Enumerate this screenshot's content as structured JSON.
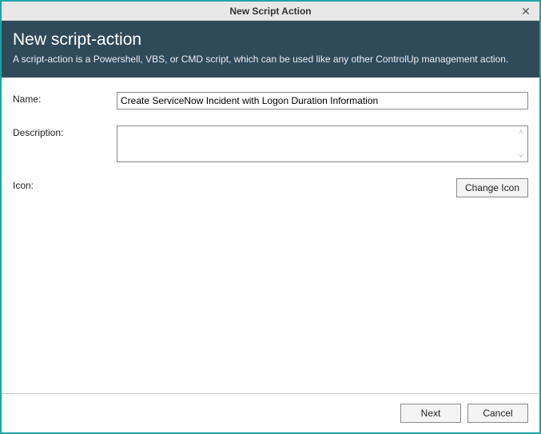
{
  "window": {
    "title": "New Script Action"
  },
  "header": {
    "heading": "New script-action",
    "description": "A script-action is a Powershell, VBS, or CMD script, which can be used like any other ControlUp management action."
  },
  "form": {
    "name_label": "Name:",
    "name_value": "Create ServiceNow Incident with Logon Duration Information",
    "description_label": "Description:",
    "description_value": "",
    "icon_label": "Icon:",
    "change_icon_button": "Change Icon"
  },
  "footer": {
    "next": "Next",
    "cancel": "Cancel"
  }
}
